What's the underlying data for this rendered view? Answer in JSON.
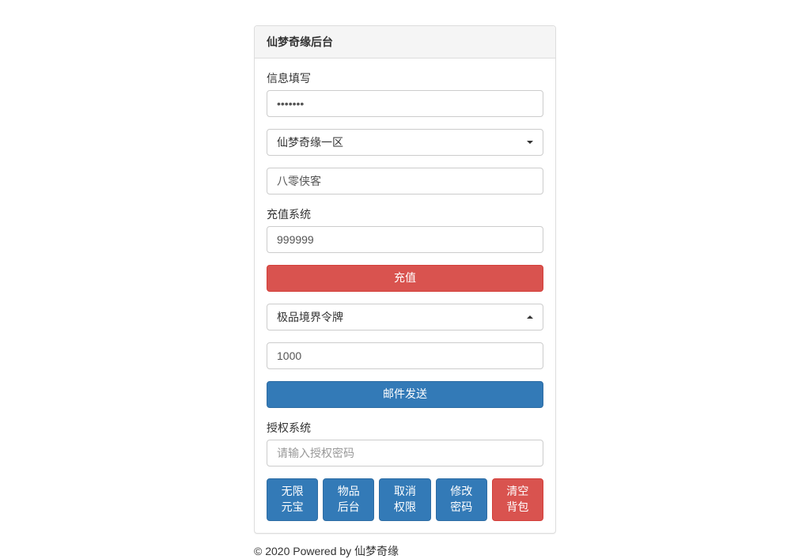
{
  "panel": {
    "title": "仙梦奇缘后台"
  },
  "info": {
    "label": "信息填写",
    "password_value": "•••••••",
    "server_select": "仙梦奇缘一区",
    "character_value": "八零侠客"
  },
  "recharge": {
    "label": "充值系统",
    "amount_value": "999999",
    "button": "充值"
  },
  "mail": {
    "item_select": "极品境界令牌",
    "quantity_value": "1000",
    "button": "邮件发送"
  },
  "auth": {
    "label": "授权系统",
    "placeholder": "请输入授权密码"
  },
  "buttons": {
    "unlimited_gold": "无限元宝",
    "item_backend": "物品后台",
    "cancel_auth": "取消权限",
    "change_password": "修改密码",
    "clear_bag": "清空背包"
  },
  "footer": "© 2020 Powered by 仙梦奇缘"
}
